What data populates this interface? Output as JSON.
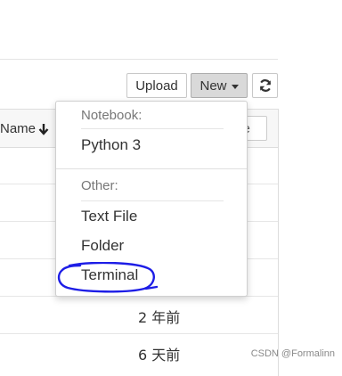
{
  "toolbar": {
    "upload_label": "Upload",
    "new_label": "New",
    "refresh_icon": "refresh-icon"
  },
  "list": {
    "name_header": "Name",
    "sort_icon": "arrow-down-icon",
    "filter_placeholder": "ze",
    "rows": [
      {
        "modified": "2 年前"
      },
      {
        "modified": "6 天前"
      }
    ]
  },
  "new_menu": {
    "notebook_header": "Notebook:",
    "notebook_items": [
      "Python 3"
    ],
    "other_header": "Other:",
    "other_items": [
      "Text File",
      "Folder",
      "Terminal"
    ]
  },
  "annotation": {
    "circle_color": "#1d1de6"
  },
  "watermark": "CSDN @Formalinn"
}
